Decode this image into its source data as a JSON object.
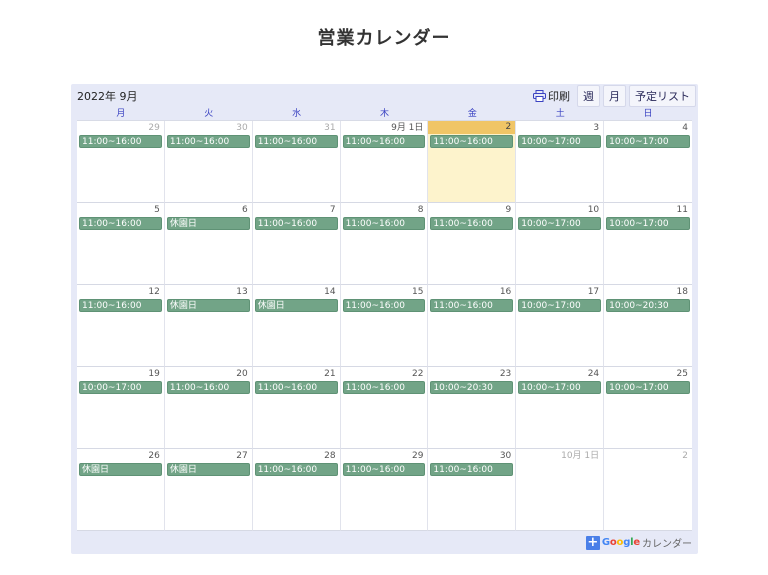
{
  "page_title": "営業カレンダー",
  "calendar": {
    "month_label": "2022年 9月",
    "toolbar": {
      "print_label": "印刷",
      "view_week": "週",
      "view_month": "月",
      "view_agenda": "予定リスト"
    },
    "weekdays": [
      "月",
      "火",
      "水",
      "木",
      "金",
      "土",
      "日"
    ],
    "weeks": [
      [
        {
          "day": "29",
          "other": true,
          "event": "11:00~16:00"
        },
        {
          "day": "30",
          "other": true,
          "event": "11:00~16:00"
        },
        {
          "day": "31",
          "other": true,
          "event": "11:00~16:00"
        },
        {
          "day": "9月 1日",
          "event": "11:00~16:00"
        },
        {
          "day": "2",
          "today": true,
          "event": "11:00~16:00"
        },
        {
          "day": "3",
          "event": "10:00~17:00"
        },
        {
          "day": "4",
          "event": "10:00~17:00"
        }
      ],
      [
        {
          "day": "5",
          "event": "11:00~16:00"
        },
        {
          "day": "6",
          "event": "休園日"
        },
        {
          "day": "7",
          "event": "11:00~16:00"
        },
        {
          "day": "8",
          "event": "11:00~16:00"
        },
        {
          "day": "9",
          "event": "11:00~16:00"
        },
        {
          "day": "10",
          "event": "10:00~17:00"
        },
        {
          "day": "11",
          "event": "10:00~17:00"
        }
      ],
      [
        {
          "day": "12",
          "event": "11:00~16:00"
        },
        {
          "day": "13",
          "event": "休園日"
        },
        {
          "day": "14",
          "event": "休園日"
        },
        {
          "day": "15",
          "event": "11:00~16:00"
        },
        {
          "day": "16",
          "event": "11:00~16:00"
        },
        {
          "day": "17",
          "event": "10:00~17:00"
        },
        {
          "day": "18",
          "event": "10:00~20:30"
        }
      ],
      [
        {
          "day": "19",
          "event": "10:00~17:00"
        },
        {
          "day": "20",
          "event": "11:00~16:00"
        },
        {
          "day": "21",
          "event": "11:00~16:00"
        },
        {
          "day": "22",
          "event": "11:00~16:00"
        },
        {
          "day": "23",
          "event": "10:00~20:30"
        },
        {
          "day": "24",
          "event": "10:00~17:00"
        },
        {
          "day": "25",
          "event": "10:00~17:00"
        }
      ],
      [
        {
          "day": "26",
          "event": "休園日"
        },
        {
          "day": "27",
          "event": "休園日"
        },
        {
          "day": "28",
          "event": "11:00~16:00"
        },
        {
          "day": "29",
          "event": "11:00~16:00"
        },
        {
          "day": "30",
          "event": "11:00~16:00"
        },
        {
          "day": "10月 1日",
          "other": true
        },
        {
          "day": "2",
          "other": true
        }
      ]
    ],
    "footer": {
      "plus_glyph": "+",
      "google_letters": [
        "G",
        "o",
        "o",
        "g",
        "l",
        "e"
      ],
      "label": "カレンダー"
    }
  },
  "colors": {
    "event_bg": "#72a487",
    "today_bg": "#fdf3cc",
    "today_header": "#f0c566",
    "frame_bg": "#e6e9f7",
    "weekday_text": "#3a42c2"
  },
  "icons": {
    "print": "printer-icon",
    "add": "plus-icon"
  }
}
